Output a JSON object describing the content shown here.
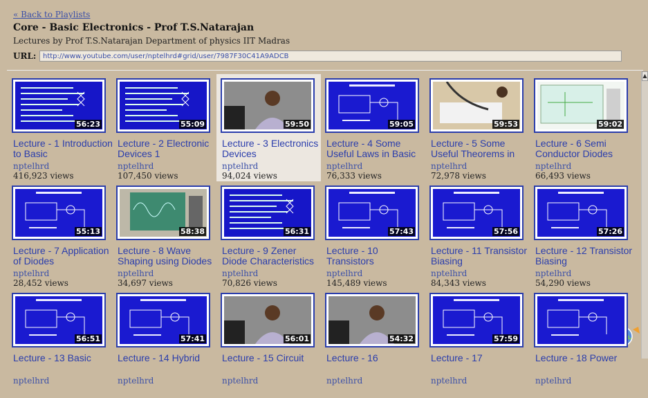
{
  "header": {
    "back_link": "« Back to Playlists",
    "title": "Core - Basic Electronics - Prof T.S.Natarajan",
    "subtitle": "Lectures by Prof T.S.Natarajan Department of physics IIT Madras"
  },
  "url": {
    "label": "URL:",
    "value": "http://www.youtube.com/user/nptelhrd#grid/user/7987F30C41A9ADCB"
  },
  "videos": [
    {
      "title": "Lecture - 1 Introduction to Basic",
      "user": "nptelhrd",
      "views": "416,923 views",
      "duration": "56:23",
      "thumb": "slide-text"
    },
    {
      "title": "Lecture - 2 Electronic Devices 1",
      "user": "nptelhrd",
      "views": "107,450 views",
      "duration": "55:09",
      "thumb": "slide-text"
    },
    {
      "title": "Lecture - 3 Electronics Devices",
      "user": "nptelhrd",
      "views": "94,024 views",
      "duration": "59:50",
      "thumb": "lecturer"
    },
    {
      "title": "Lecture - 4 Some Useful Laws in Basic",
      "user": "nptelhrd",
      "views": "76,333 views",
      "duration": "59:05",
      "thumb": "slide-circuit"
    },
    {
      "title": "Lecture - 5 Some Useful Theorems in",
      "user": "nptelhrd",
      "views": "72,978 views",
      "duration": "59:53",
      "thumb": "breadboard"
    },
    {
      "title": "Lecture - 6 Semi Conductor Diodes",
      "user": "nptelhrd",
      "views": "66,493 views",
      "duration": "59:02",
      "thumb": "software"
    },
    {
      "title": "Lecture - 7 Application of Diodes",
      "user": "nptelhrd",
      "views": "28,452 views",
      "duration": "55:13",
      "thumb": "slide-circuit"
    },
    {
      "title": "Lecture - 8 Wave Shaping using Diodes",
      "user": "nptelhrd",
      "views": "34,697 views",
      "duration": "58:38",
      "thumb": "oscilloscope"
    },
    {
      "title": "Lecture - 9 Zener Diode Characteristics",
      "user": "nptelhrd",
      "views": "70,826 views",
      "duration": "56:31",
      "thumb": "slide-text"
    },
    {
      "title": "Lecture - 10 Transistors",
      "user": "nptelhrd",
      "views": "145,489 views",
      "duration": "57:43",
      "thumb": "slide-circuit"
    },
    {
      "title": "Lecture - 11 Transistor Biasing",
      "user": "nptelhrd",
      "views": "84,343 views",
      "duration": "57:56",
      "thumb": "slide-circuit"
    },
    {
      "title": "Lecture - 12 Transistor Biasing",
      "user": "nptelhrd",
      "views": "54,290 views",
      "duration": "57:26",
      "thumb": "slide-circuit"
    },
    {
      "title": "Lecture - 13 Basic",
      "user": "nptelhrd",
      "views": "",
      "duration": "56:51",
      "thumb": "slide-circuit"
    },
    {
      "title": "Lecture - 14 Hybrid",
      "user": "nptelhrd",
      "views": "",
      "duration": "57:41",
      "thumb": "slide-circuit"
    },
    {
      "title": "Lecture - 15 Circuit",
      "user": "nptelhrd",
      "views": "",
      "duration": "56:01",
      "thumb": "lecturer"
    },
    {
      "title": "Lecture - 16",
      "user": "nptelhrd",
      "views": "",
      "duration": "54:32",
      "thumb": "lecturer"
    },
    {
      "title": "Lecture - 17",
      "user": "nptelhrd",
      "views": "",
      "duration": "57:59",
      "thumb": "slide-circuit"
    },
    {
      "title": "Lecture - 18 Power",
      "user": "nptelhrd",
      "views": "",
      "duration": "",
      "thumb": "slide-circuit"
    }
  ],
  "selected_index": 2,
  "colors": {
    "background": "#c9b9a0",
    "link": "#2a3dac",
    "thumb_border": "#2a3dac",
    "slide_blue": "#1a1ad0"
  }
}
